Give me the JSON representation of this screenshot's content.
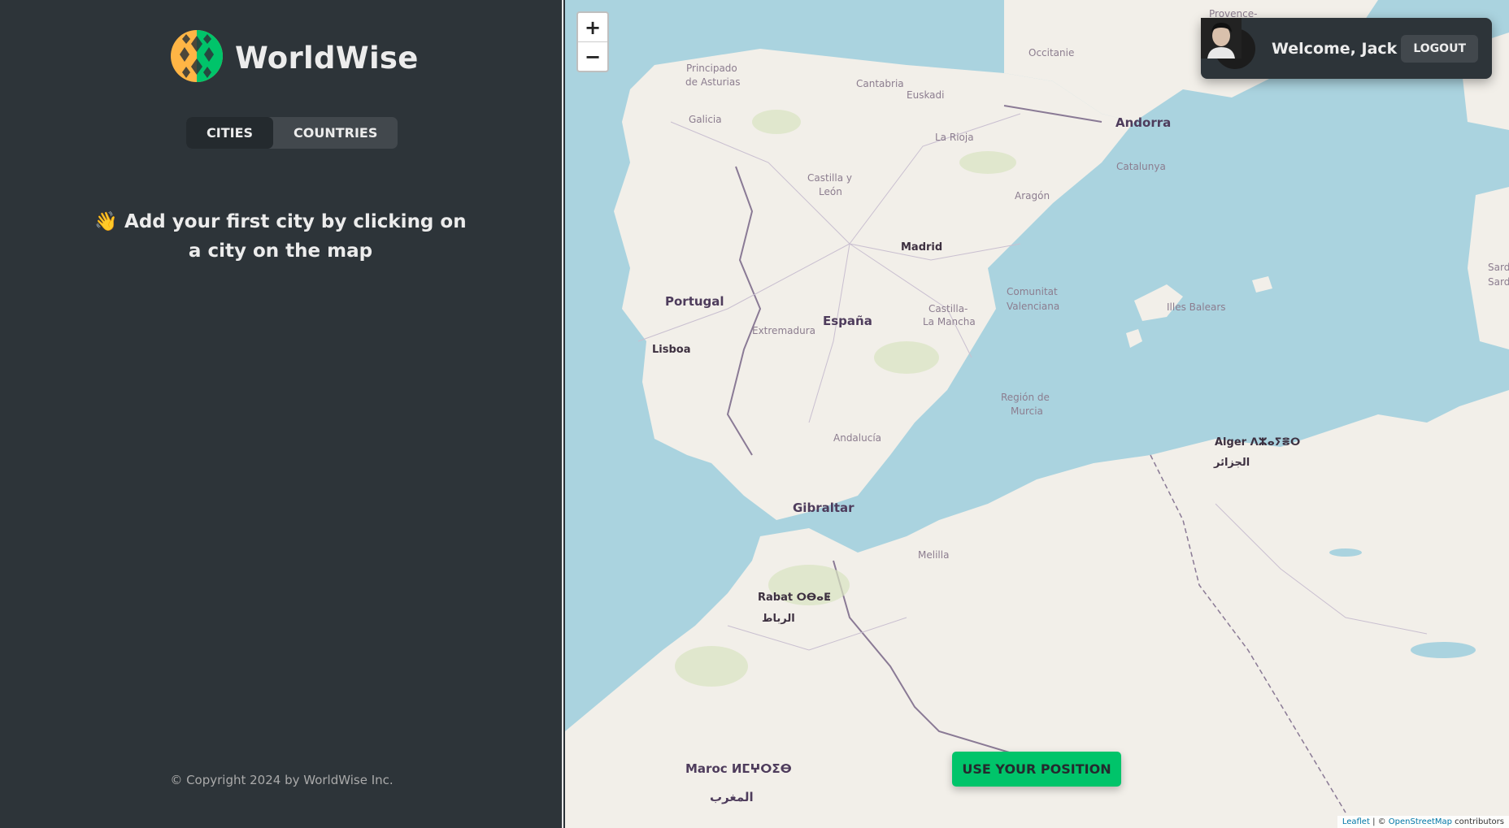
{
  "sidebar": {
    "logo_text": "WorldWise",
    "tabs": [
      {
        "label": "CITIES"
      },
      {
        "label": "COUNTRIES"
      }
    ],
    "empty_message": "👋 Add your first city by clicking on a city on the map",
    "footer": "© Copyright 2024 by WorldWise Inc."
  },
  "map": {
    "zoom_in": "+",
    "zoom_out": "−",
    "labels": {
      "principado": "Principado",
      "asturias": "de Asturias",
      "cantabria": "Cantabria",
      "euskadi": "Euskadi",
      "galicia": "Galicia",
      "andorra": "Andorra",
      "la_rioja": "La Rioja",
      "catalunya": "Catalunya",
      "castilla_y": "Castilla y",
      "leon": "León",
      "aragon": "Aragón",
      "madrid": "Madrid",
      "portugal": "Portugal",
      "espana": "España",
      "comunitat": "Comunitat",
      "valenciana": "Valenciana",
      "illes_balears": "Illes Balears",
      "extremadura": "Extremadura",
      "castilla_la": "Castilla-",
      "la_mancha": "La Mancha",
      "sardigna": "Sardigna",
      "sardegna": "Sardegna",
      "lisboa": "Lisboa",
      "region_de": "Región de",
      "murcia": "Murcia",
      "andalucia": "Andalucía",
      "alger": "Alger ⴷⵣⴰⵢⴻⵔ",
      "alger_ar": "الجزائر",
      "gibraltar": "Gibraltar",
      "melilla": "Melilla",
      "rabat": "Rabat ⵔⴱⴰⵟ",
      "rabat_ar": "الرباط",
      "maroc": "Maroc ⵍⵎⵖⵔⵉⴱ",
      "maroc_ar": "المغرب",
      "occitanie": "Occitanie",
      "provence": "Provence-"
    },
    "attribution_leaflet": "Leaflet",
    "attribution_sep": " | © ",
    "attribution_osm": "OpenStreetMap",
    "attribution_tail": " contributors"
  },
  "user": {
    "welcome": "Welcome, Jack",
    "logout_label": "LOGOUT"
  },
  "position_button": "USE YOUR POSITION",
  "colors": {
    "sidebar_bg": "#2d3439",
    "brand_green": "#00c46a",
    "water": "#aad3df",
    "land": "#f2efe9"
  }
}
